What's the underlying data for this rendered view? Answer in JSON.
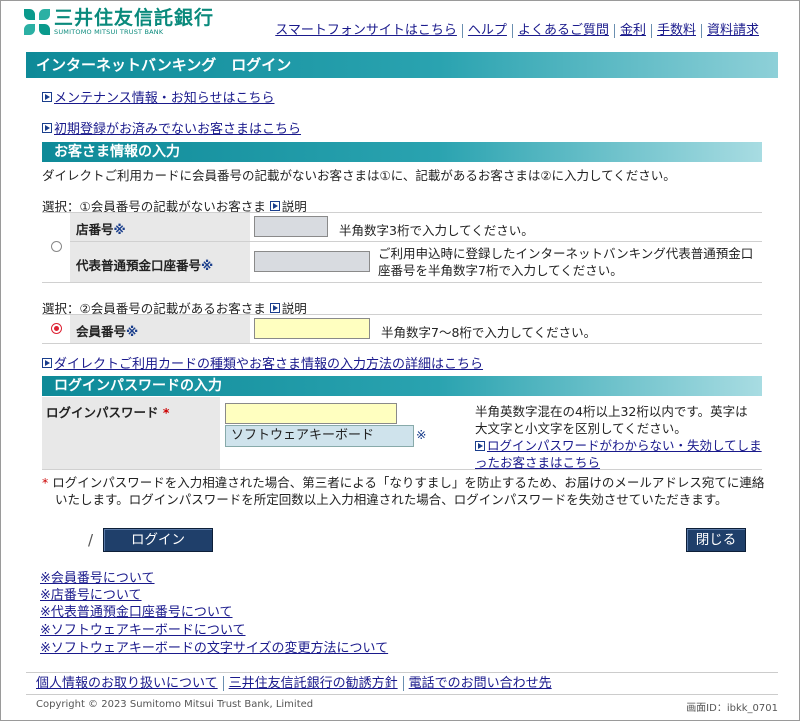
{
  "header": {
    "logo_jp": "三井住友信託銀行",
    "logo_en": "SUMITOMO MITSUI TRUST BANK",
    "nav": [
      "スマートフォンサイトはこちら",
      "ヘルプ",
      "よくあるご質問",
      "金利",
      "手数料",
      "資料請求"
    ]
  },
  "page_title": "インターネットバンキング　ログイン",
  "links": {
    "maintenance": "メンテナンス情報・お知らせはこちら",
    "initial_registration": "初期登録がお済みでないお客さまはこちら"
  },
  "customer_section": {
    "title": "お客さま情報の入力",
    "instruction": "ダイレクトご利用カードに会員番号の記載がないお客さまは①に、記載があるお客さまは②に入力してください。",
    "option1_label": "選択：①会員番号の記載がないお客さま",
    "option2_label": "選択：②会員番号の記載があるお客さま",
    "explain": "説明",
    "branch_label": "店番号",
    "branch_hint": "半角数字3桁で入力してください。",
    "account_label": "代表普通預金口座番号",
    "account_hint_1": "ご利用申込時に登録したインターネットバンキング代表普通預金口",
    "account_hint_2": "座番号を半角数字7桁で入力してください。",
    "member_label": "会員番号",
    "member_hint": "半角数字7～8桁で入力してください。",
    "asterisk": "※",
    "detail_link": "ダイレクトご利用カードの種類やお客さま情報の入力方法の詳細はこちら"
  },
  "password_section": {
    "title": "ログインパスワードの入力",
    "label": "ログインパスワード",
    "star": "*",
    "software_keyboard": "ソフトウェアキーボード",
    "asterisk": "※",
    "hint_1": "半角英数字混在の4桁以上32桁以内です。英字は",
    "hint_2": "大文字と小文字を区別してください。",
    "forgot_1": "ログインパスワードがわからない・失効してしま",
    "forgot_2": "ったお客さまはこちら"
  },
  "warning": {
    "star": "*",
    "line1": "ログインパスワードを入力相違された場合、第三者による「なりすまし」を防止するため、お届けのメールアドレス宛てに連絡",
    "line2": "いたします。ログインパスワードを所定回数以上入力相違された場合、ログインパスワードを失効させていただきます。"
  },
  "actions": {
    "slash": "/",
    "login": "ログイン",
    "close": "閉じる"
  },
  "notes": [
    "※会員番号について",
    "※店番号について",
    "※代表普通預金口座番号について",
    "※ソフトウェアキーボードについて",
    "※ソフトウェアキーボードの文字サイズの変更方法について"
  ],
  "footer": {
    "links": [
      "個人情報のお取り扱いについて",
      "三井住友信託銀行の勧誘方針",
      "電話でのお問い合わせ先"
    ],
    "copyright": "Copyright © 2023 Sumitomo Mitsui Trust Bank, Limited",
    "screen_id": "画面ID：ibkk_0701"
  },
  "colors": {
    "accent_teal": "#0e8a98",
    "button_navy": "#1f3f6a",
    "link_blue": "#1a1a8c",
    "required_red": "#cc0000",
    "input_yellow": "#ffffc0"
  }
}
